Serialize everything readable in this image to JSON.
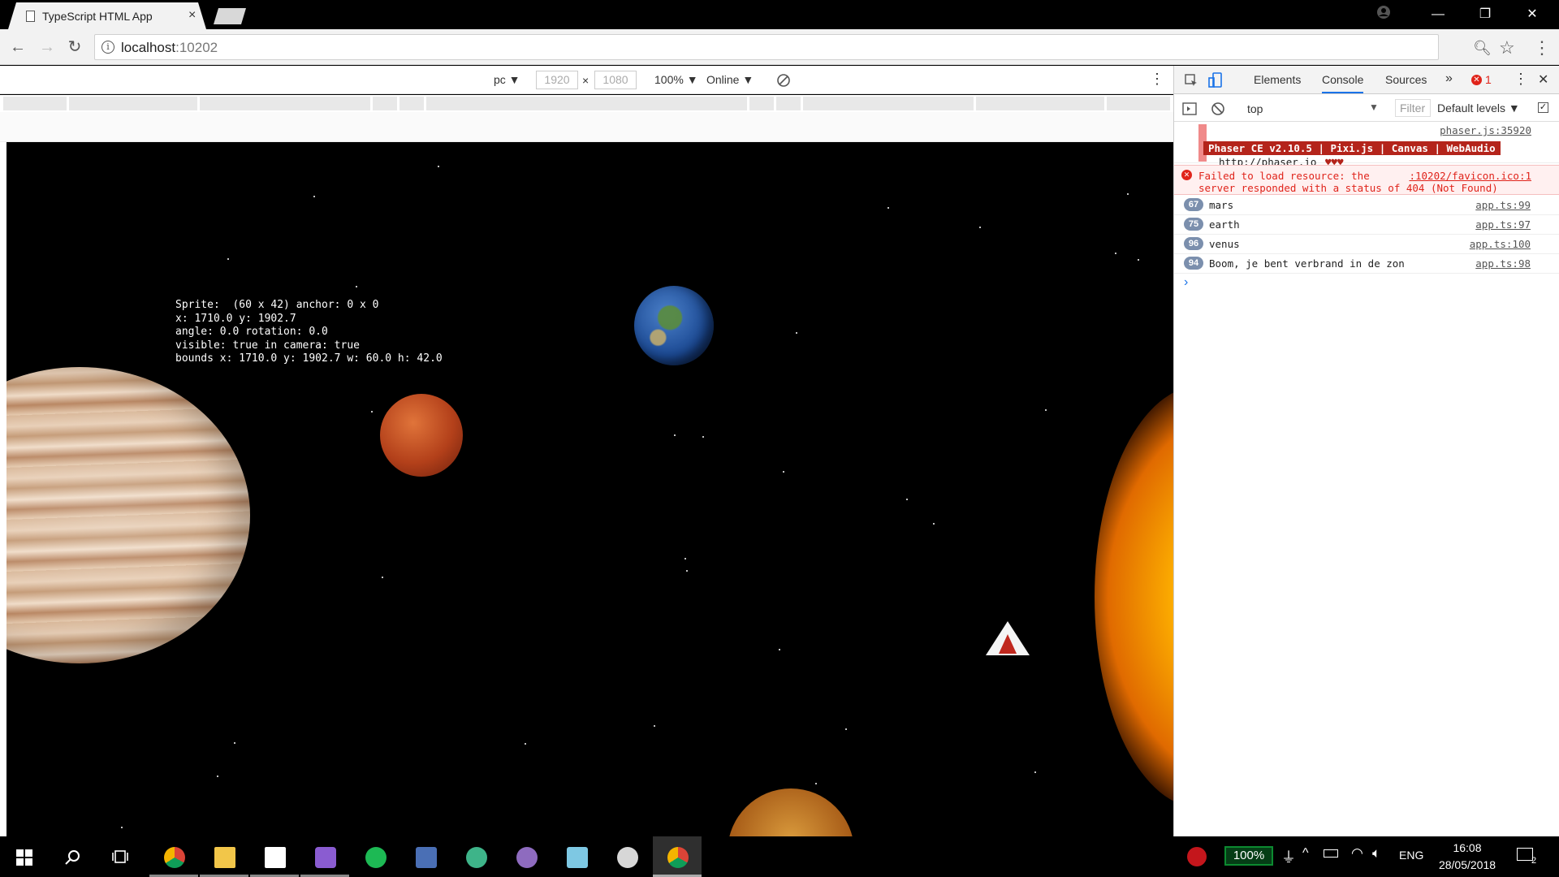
{
  "browser": {
    "tab_title": "TypeScript HTML App",
    "tab_close": "×",
    "url_host": "localhost",
    "url_port": ":10202"
  },
  "device_toolbar": {
    "device": "pc ▼",
    "width": "1920",
    "times": "×",
    "height": "1080",
    "zoom": "100% ▼",
    "throttle": "Online ▼",
    "more": "⋮"
  },
  "game": {
    "debug_lines": [
      "Sprite:  (60 x 42) anchor: 0 x 0",
      "x: 1710.0 y: 1902.7",
      "angle: 0.0 rotation: 0.0",
      "visible: true in camera: true",
      "bounds x: 1710.0 y: 1902.7 w: 60.0 h: 42.0"
    ]
  },
  "devtools": {
    "tabs": [
      "Elements",
      "Console",
      "Sources"
    ],
    "more_tabs": "»",
    "error_count": "1",
    "context": "top",
    "filter_placeholder": "Filter",
    "levels": "Default levels ▼",
    "phaser_src": "phaser.js:35920",
    "phaser_banner": "Phaser CE v2.10.5 | Pixi.js | Canvas | WebAudio",
    "phaser_link": "http://phaser.io",
    "phaser_hearts": "♥♥♥",
    "error_msg_1": "Failed to load resource: the",
    "error_msg_2": "server responded with a status of 404 (Not Found)",
    "error_src": ":10202/favicon.ico:1",
    "logs": [
      {
        "count": "67",
        "msg": "mars",
        "src": "app.ts:99"
      },
      {
        "count": "75",
        "msg": "earth",
        "src": "app.ts:97"
      },
      {
        "count": "96",
        "msg": "venus",
        "src": "app.ts:100"
      },
      {
        "count": "94",
        "msg": "Boom, je bent verbrand in de zon",
        "src": "app.ts:98"
      }
    ],
    "prompt": "›"
  },
  "taskbar": {
    "battery": "100%",
    "language": "ENG",
    "time": "16:08",
    "date": "28/05/2018",
    "notifications": "2"
  },
  "colors": {
    "accent": "#1a73e8",
    "error": "#e0241b",
    "phaser_red": "#b4241b",
    "badge": "#7b8fad"
  }
}
